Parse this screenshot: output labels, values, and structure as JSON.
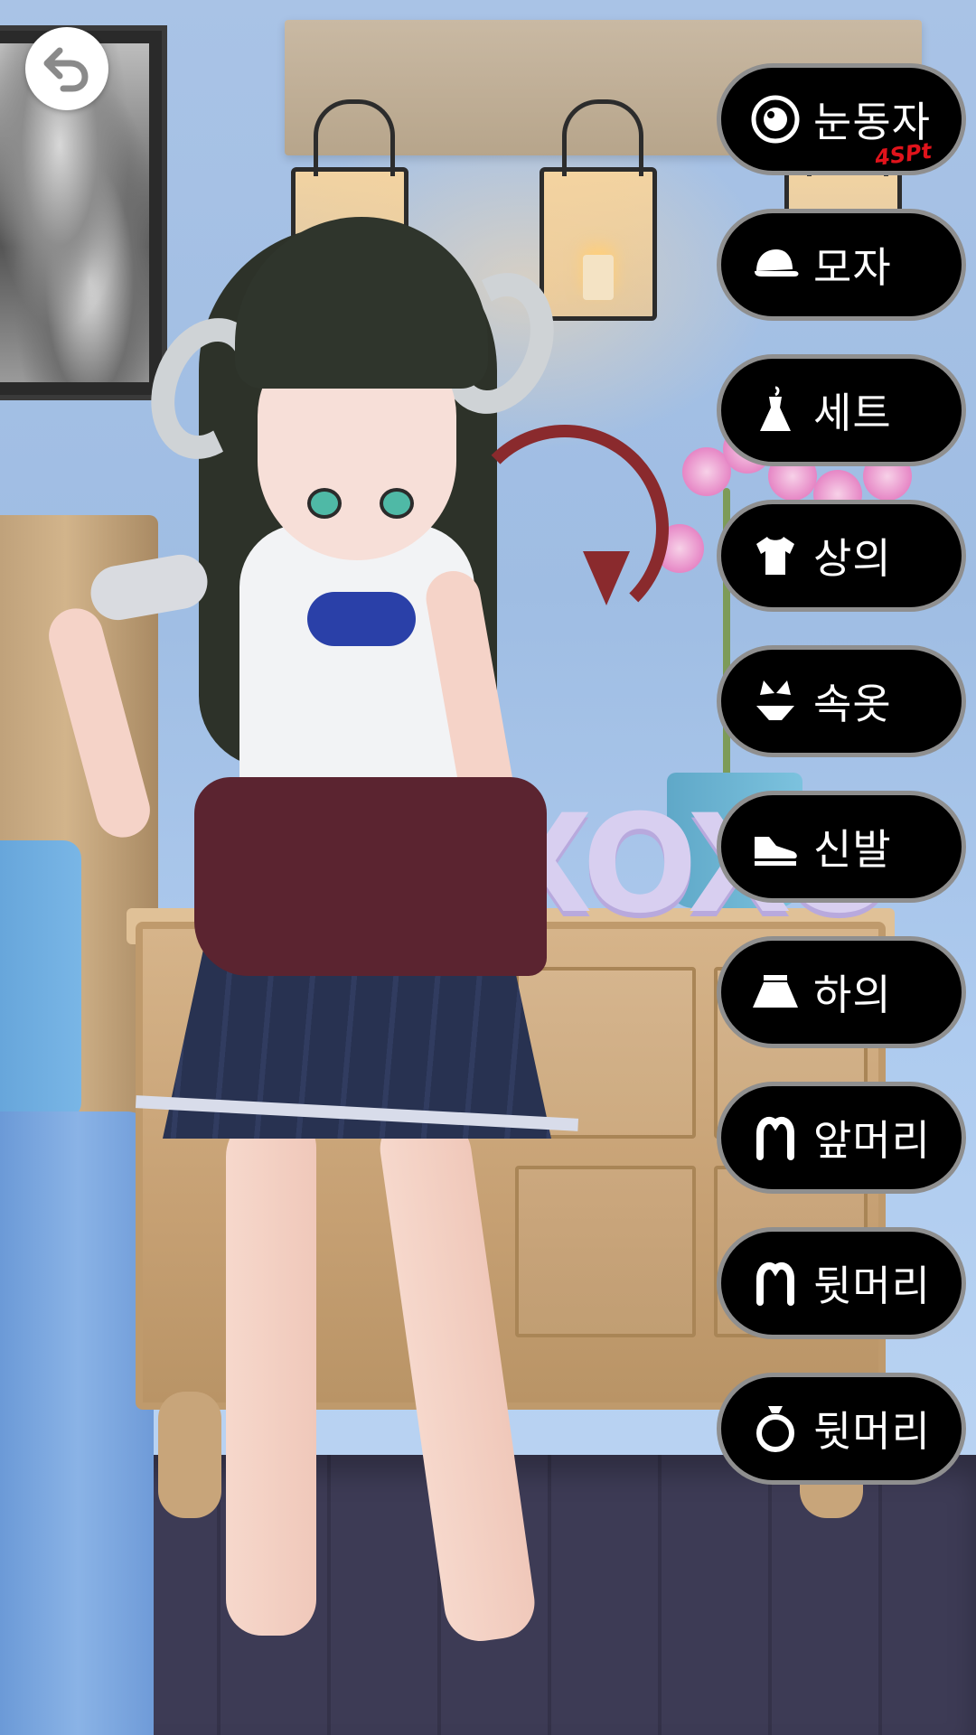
{
  "navigation": {
    "back_icon": "back-arrow-icon"
  },
  "menu": {
    "items": [
      {
        "label": "눈동자",
        "icon": "eye-icon",
        "badge": "4SPt"
      },
      {
        "label": "모자",
        "icon": "cap-icon"
      },
      {
        "label": "세트",
        "icon": "dress-icon"
      },
      {
        "label": "상의",
        "icon": "tshirt-icon"
      },
      {
        "label": "속옷",
        "icon": "bikini-icon"
      },
      {
        "label": "신발",
        "icon": "sneaker-icon"
      },
      {
        "label": "하의",
        "icon": "skirt-icon"
      },
      {
        "label": "앞머리",
        "icon": "front-hair-icon"
      },
      {
        "label": "뒷머리",
        "icon": "back-hair-icon"
      },
      {
        "label": "뒷머리",
        "icon": "ring-icon"
      }
    ]
  },
  "scene": {
    "wall_sign": "XOXO"
  },
  "colors": {
    "button_background": "#000000",
    "button_border": "#8f8f8f",
    "button_text": "#ffffff",
    "badge": "#e0131b"
  }
}
